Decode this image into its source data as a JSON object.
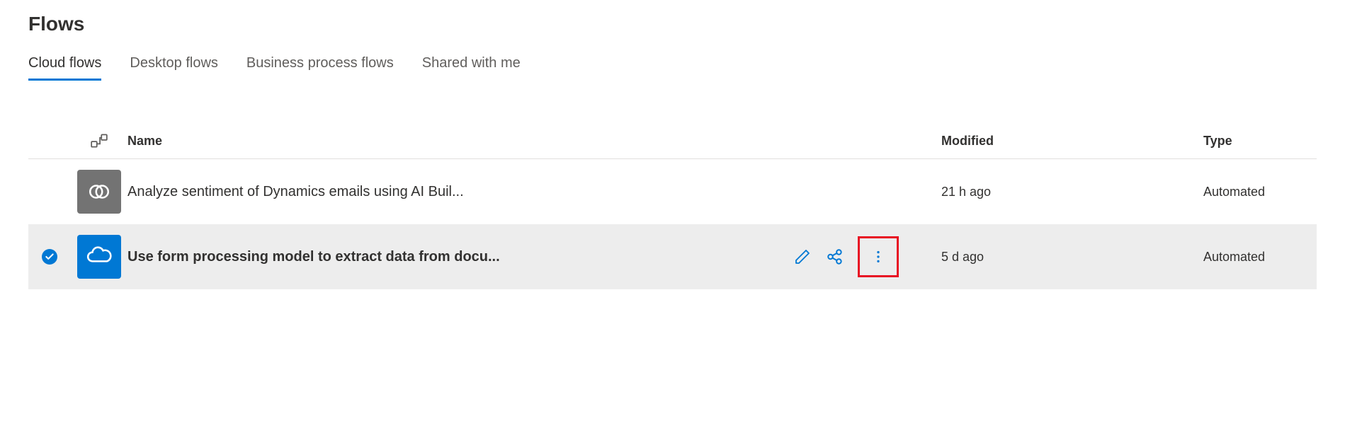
{
  "page": {
    "title": "Flows"
  },
  "tabs": [
    {
      "label": "Cloud flows",
      "active": true
    },
    {
      "label": "Desktop flows",
      "active": false
    },
    {
      "label": "Business process flows",
      "active": false
    },
    {
      "label": "Shared with me",
      "active": false
    }
  ],
  "table": {
    "headers": {
      "name": "Name",
      "modified": "Modified",
      "type": "Type"
    },
    "rows": [
      {
        "selected": false,
        "icon_color": "gray",
        "icon_kind": "dynamics",
        "name": "Analyze sentiment of Dynamics emails using AI Buil...",
        "modified": "21 h ago",
        "type": "Automated"
      },
      {
        "selected": true,
        "icon_color": "blue",
        "icon_kind": "onedrive",
        "name": "Use form processing model to extract data from docu...",
        "modified": "5 d ago",
        "type": "Automated"
      }
    ]
  }
}
